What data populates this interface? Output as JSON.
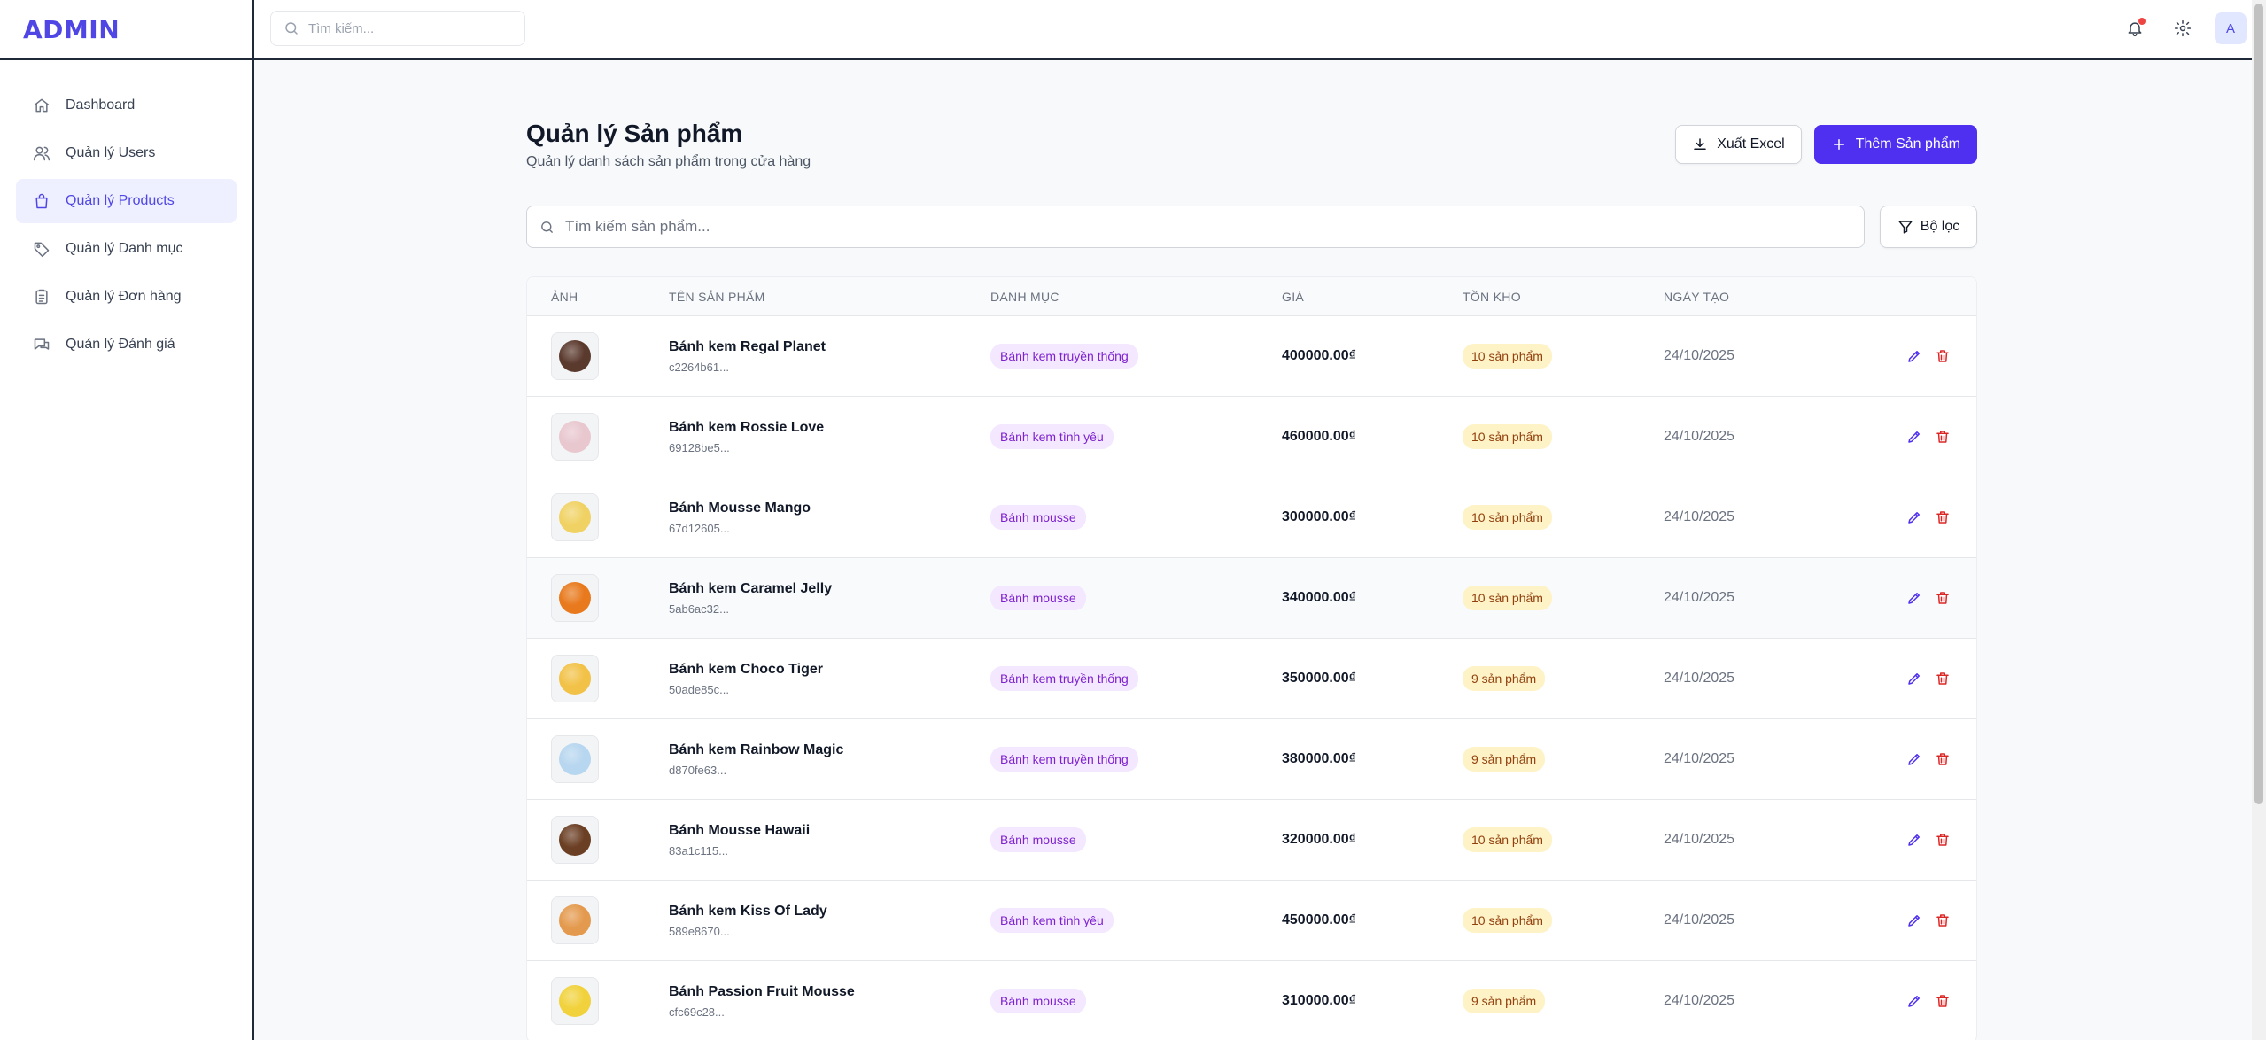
{
  "brand": {
    "logo": "ADMIN"
  },
  "sidebar": {
    "items": [
      {
        "label": "Dashboard",
        "icon": "home-icon",
        "active": false
      },
      {
        "label": "Quản lý Users",
        "icon": "users-icon",
        "active": false
      },
      {
        "label": "Quản lý Products",
        "icon": "shopping-bag-icon",
        "active": true
      },
      {
        "label": "Quản lý Danh mục",
        "icon": "tag-icon",
        "active": false
      },
      {
        "label": "Quản lý Đơn hàng",
        "icon": "clipboard-icon",
        "active": false
      },
      {
        "label": "Quản lý Đánh giá",
        "icon": "chat-icon",
        "active": false
      }
    ]
  },
  "topbar": {
    "search_placeholder": "Tìm kiếm...",
    "avatar_initial": "A"
  },
  "page": {
    "title": "Quản lý Sản phẩm",
    "subtitle": "Quản lý danh sách sản phẩm trong cửa hàng",
    "export_label": "Xuất Excel",
    "add_label": "Thêm Sản phẩm",
    "search_placeholder": "Tìm kiếm sản phẩm...",
    "filter_label": "Bộ lọc"
  },
  "table": {
    "columns": [
      "ẢNH",
      "TÊN SẢN PHẨM",
      "DANH MỤC",
      "GIÁ",
      "TỒN KHO",
      "NGÀY TẠO"
    ],
    "rows": [
      {
        "name": "Bánh kem Regal Planet",
        "id": "c2264b61...",
        "category": "Bánh kem truyền thống",
        "price": "400000.00₫",
        "stock": "10 sản phẩm",
        "date": "24/10/2025",
        "cake_color": "#5b3a2e"
      },
      {
        "name": "Bánh kem Rossie Love",
        "id": "69128be5...",
        "category": "Bánh kem tình yêu",
        "price": "460000.00₫",
        "stock": "10 sản phẩm",
        "date": "24/10/2025",
        "cake_color": "#e8c7cf"
      },
      {
        "name": "Bánh Mousse Mango",
        "id": "67d12605...",
        "category": "Bánh mousse",
        "price": "300000.00₫",
        "stock": "10 sản phẩm",
        "date": "24/10/2025",
        "cake_color": "#f0d264"
      },
      {
        "name": "Bánh kem Caramel Jelly",
        "id": "5ab6ac32...",
        "category": "Bánh mousse",
        "price": "340000.00₫",
        "stock": "10 sản phẩm",
        "date": "24/10/2025",
        "cake_color": "#e8791c"
      },
      {
        "name": "Bánh kem Choco Tiger",
        "id": "50ade85c...",
        "category": "Bánh kem truyền thống",
        "price": "350000.00₫",
        "stock": "9 sản phẩm",
        "date": "24/10/2025",
        "cake_color": "#f2c248"
      },
      {
        "name": "Bánh kem Rainbow Magic",
        "id": "d870fe63...",
        "category": "Bánh kem truyền thống",
        "price": "380000.00₫",
        "stock": "9 sản phẩm",
        "date": "24/10/2025",
        "cake_color": "#b7d6ef"
      },
      {
        "name": "Bánh Mousse Hawaii",
        "id": "83a1c115...",
        "category": "Bánh mousse",
        "price": "320000.00₫",
        "stock": "10 sản phẩm",
        "date": "24/10/2025",
        "cake_color": "#6b3f24"
      },
      {
        "name": "Bánh kem Kiss Of Lady",
        "id": "589e8670...",
        "category": "Bánh kem tình yêu",
        "price": "450000.00₫",
        "stock": "10 sản phẩm",
        "date": "24/10/2025",
        "cake_color": "#e49a4e"
      },
      {
        "name": "Bánh Passion Fruit Mousse",
        "id": "cfc69c28...",
        "category": "Bánh mousse",
        "price": "310000.00₫",
        "stock": "9 sản phẩm",
        "date": "24/10/2025",
        "cake_color": "#f1d23c"
      }
    ]
  },
  "colors": {
    "accent": "#4f2ff0",
    "logo": "#4f46e5",
    "category_badge_bg": "#f3e8ff",
    "stock_badge_bg": "#fef3c7",
    "delete": "#dc2626",
    "notification_dot": "#ef4444"
  }
}
